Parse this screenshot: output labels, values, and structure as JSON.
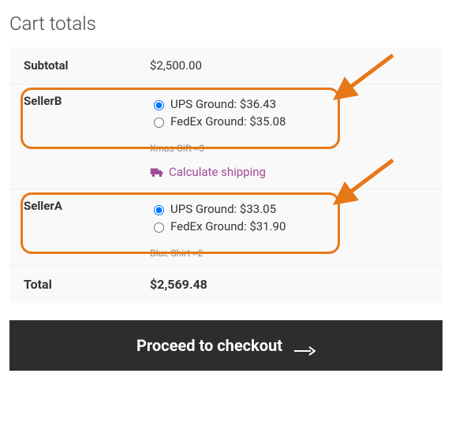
{
  "title": "Cart totals",
  "subtotal": {
    "label": "Subtotal",
    "value": "$2,500.00"
  },
  "sellers": [
    {
      "name": "SellerB",
      "options": [
        {
          "label": "UPS Ground: $36.43",
          "selected": true
        },
        {
          "label": "FedEx Ground: $35.08",
          "selected": false
        }
      ],
      "items": "Xmas Gift ×3",
      "show_calc": true
    },
    {
      "name": "SellerA",
      "options": [
        {
          "label": "UPS Ground: $33.05",
          "selected": true
        },
        {
          "label": "FedEx Ground: $31.90",
          "selected": false
        }
      ],
      "items": "Blue Shirt ×2",
      "show_calc": false
    }
  ],
  "calc_link": "Calculate shipping",
  "total": {
    "label": "Total",
    "value": "$2,569.48"
  },
  "checkout": "Proceed to checkout",
  "colors": {
    "accent": "#a14a9a",
    "highlight": "#e77817",
    "button": "#2d2d2d"
  }
}
